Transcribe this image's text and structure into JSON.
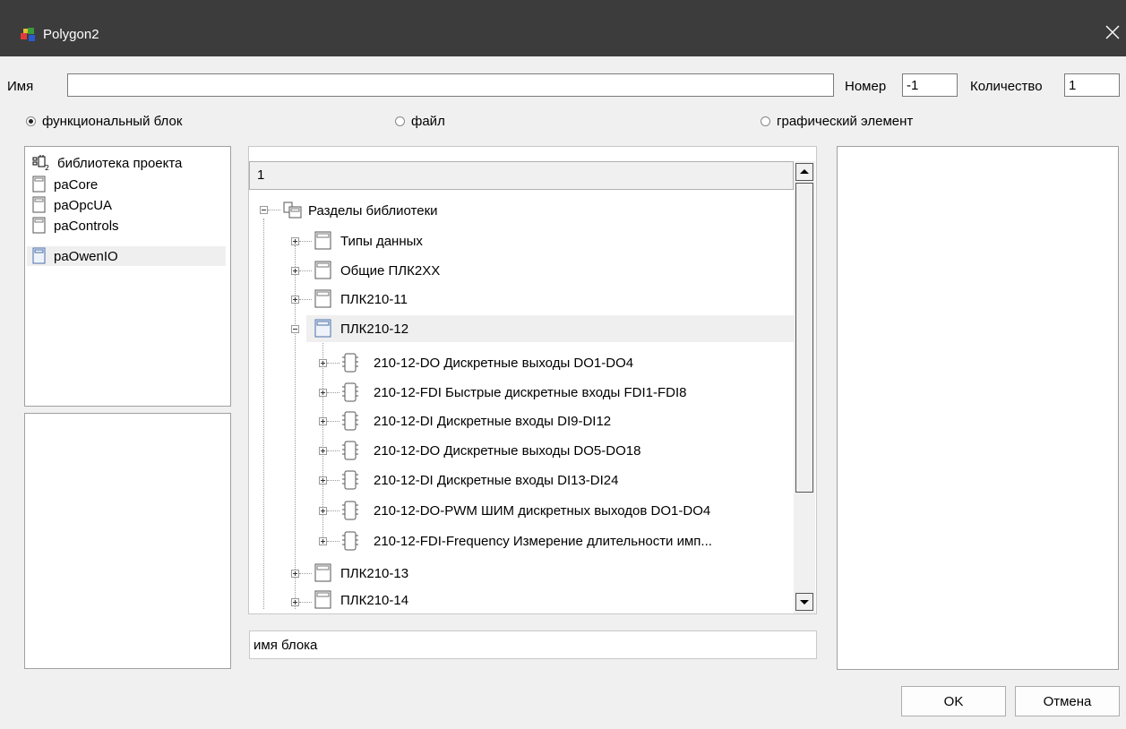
{
  "window": {
    "title": "Polygon2",
    "close_glyph": "✕"
  },
  "fields": {
    "name_label": "Имя",
    "name_value": "",
    "number_label": "Номер",
    "number_value": "-1",
    "count_label": "Количество",
    "count_value": "1"
  },
  "radios": [
    {
      "label": "функциональный блок",
      "checked": true
    },
    {
      "label": "файл",
      "checked": false
    },
    {
      "label": "графический элемент",
      "checked": false
    }
  ],
  "libraries": [
    {
      "label": "библиотека проекта",
      "icon": "project-library-icon"
    },
    {
      "label": "paCore",
      "icon": "library-book-icon"
    },
    {
      "label": "paOpcUA",
      "icon": "library-book-icon"
    },
    {
      "label": "paControls",
      "icon": "library-book-icon"
    },
    {
      "label": "paOwenIO",
      "icon": "library-book-icon",
      "selected": true
    }
  ],
  "tree": {
    "header": "1",
    "items": [
      {
        "label": "Разделы библиотеки",
        "level": 0,
        "icon": "library-sections-icon"
      },
      {
        "label": "Типы данных",
        "level": 1,
        "icon": "book-icon"
      },
      {
        "label": "Общие ПЛК2XX",
        "level": 1,
        "icon": "book-icon"
      },
      {
        "label": "ПЛК210-11",
        "level": 1,
        "icon": "book-icon"
      },
      {
        "label": "ПЛК210-12",
        "level": 1,
        "icon": "book-icon",
        "selected": true
      },
      {
        "label": "210-12-DO Дискретные выходы DO1-DO4",
        "level": 2,
        "icon": "chip-icon"
      },
      {
        "label": "210-12-FDI Быстрые дискретные входы FDI1-FDI8",
        "level": 2,
        "icon": "chip-icon"
      },
      {
        "label": "210-12-DI Дискретные входы DI9-DI12",
        "level": 2,
        "icon": "chip-icon"
      },
      {
        "label": "210-12-DO Дискретные выходы DO5-DO18",
        "level": 2,
        "icon": "chip-icon"
      },
      {
        "label": "210-12-DI Дискретные входы DI13-DI24",
        "level": 2,
        "icon": "chip-icon"
      },
      {
        "label": "210-12-DO-PWM ШИМ дискретных выходов DO1-DO4",
        "level": 2,
        "icon": "chip-icon"
      },
      {
        "label": "210-12-FDI-Frequency Измерение длительности имп...",
        "level": 2,
        "icon": "chip-icon"
      },
      {
        "label": "ПЛК210-13",
        "level": 1,
        "icon": "book-icon"
      },
      {
        "label": "ПЛК210-14",
        "level": 1,
        "icon": "book-icon"
      }
    ]
  },
  "block_name": "имя блока",
  "buttons": {
    "ok": "OK",
    "cancel": "Отмена"
  }
}
